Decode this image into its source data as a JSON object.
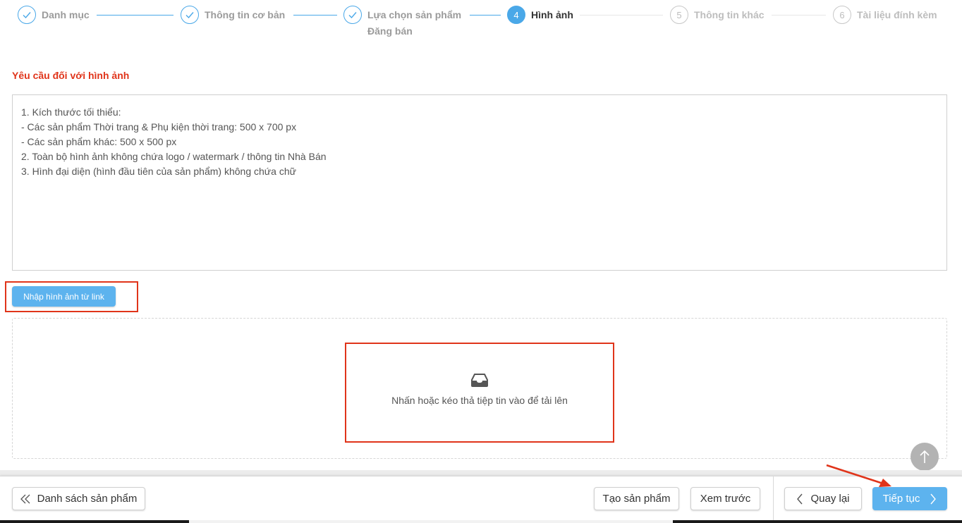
{
  "steps": [
    {
      "label": "Danh mục",
      "state": "done"
    },
    {
      "label": "Thông tin cơ bản",
      "state": "done"
    },
    {
      "label": "Lựa chọn sản phẩm",
      "label2": "Đăng bán",
      "state": "done"
    },
    {
      "number": "4",
      "label": "Hình ảnh",
      "state": "active"
    },
    {
      "number": "5",
      "label": "Thông tin khác",
      "state": "todo"
    },
    {
      "number": "6",
      "label": "Tài liệu đính kèm",
      "state": "todo"
    }
  ],
  "requirements": {
    "title": "Yêu cầu đối với hình ảnh",
    "lines": [
      "1. Kích thước tối thiểu:",
      "- Các sản phẩm Thời trang & Phụ kiện thời trang: 500 x 700 px",
      "- Các sản phẩm khác: 500 x 500 px",
      "2. Toàn bộ hình ảnh không chứa logo / watermark / thông tin Nhà Bán",
      "3. Hình đại diện (hình đầu tiên của sản phẩm) không chứa chữ"
    ]
  },
  "upload": {
    "link_button": "Nhập hình ảnh từ link",
    "dropzone_text": "Nhấn hoặc kéo thả tiệp tin vào để tải lên",
    "icon": "inbox-icon"
  },
  "footer": {
    "product_list": "Danh sách sản phẩm",
    "create_product": "Tạo sản phẩm",
    "preview": "Xem trước",
    "back": "Quay lại",
    "next": "Tiếp tục"
  },
  "colors": {
    "accent": "#4aa8e8",
    "button_primary": "#5db3ee",
    "highlight": "#e0341a"
  }
}
